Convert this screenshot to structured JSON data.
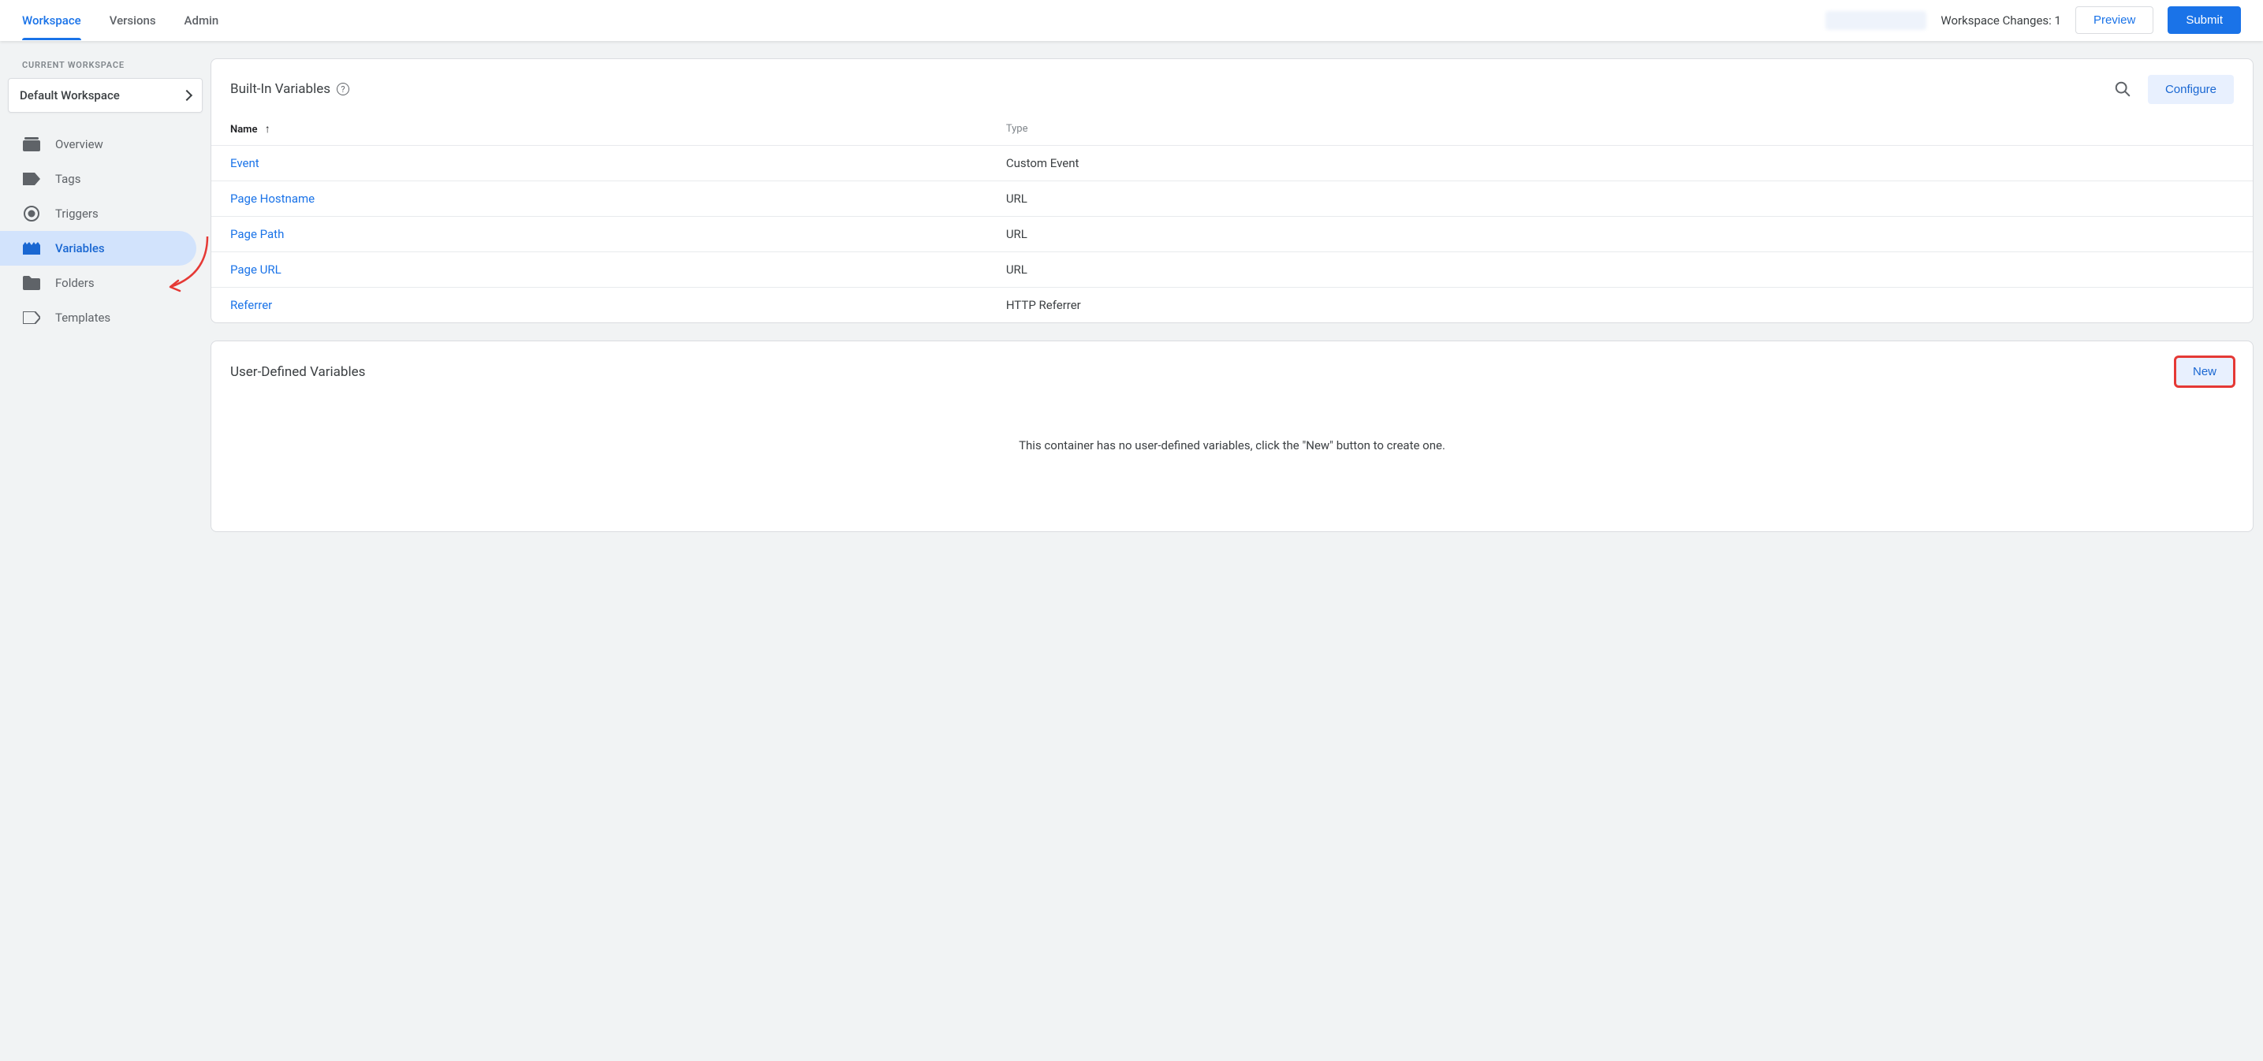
{
  "topbar": {
    "tabs": [
      {
        "label": "Workspace",
        "active": true
      },
      {
        "label": "Versions",
        "active": false
      },
      {
        "label": "Admin",
        "active": false
      }
    ],
    "changes_label": "Workspace Changes: 1",
    "preview_label": "Preview",
    "submit_label": "Submit"
  },
  "sidebar": {
    "current_workspace_label": "CURRENT WORKSPACE",
    "workspace_name": "Default Workspace",
    "items": [
      {
        "label": "Overview",
        "icon": "overview-icon"
      },
      {
        "label": "Tags",
        "icon": "tag-icon"
      },
      {
        "label": "Triggers",
        "icon": "trigger-icon"
      },
      {
        "label": "Variables",
        "icon": "variables-icon",
        "active": true
      },
      {
        "label": "Folders",
        "icon": "folder-icon"
      },
      {
        "label": "Templates",
        "icon": "template-icon"
      }
    ]
  },
  "builtin": {
    "title": "Built-In Variables",
    "configure_label": "Configure",
    "columns": {
      "name": "Name",
      "type": "Type"
    },
    "rows": [
      {
        "name": "Event",
        "type": "Custom Event"
      },
      {
        "name": "Page Hostname",
        "type": "URL"
      },
      {
        "name": "Page Path",
        "type": "URL"
      },
      {
        "name": "Page URL",
        "type": "URL"
      },
      {
        "name": "Referrer",
        "type": "HTTP Referrer"
      }
    ]
  },
  "userdef": {
    "title": "User-Defined Variables",
    "new_label": "New",
    "empty_message": "This container has no user-defined variables, click the \"New\" button to create one."
  }
}
